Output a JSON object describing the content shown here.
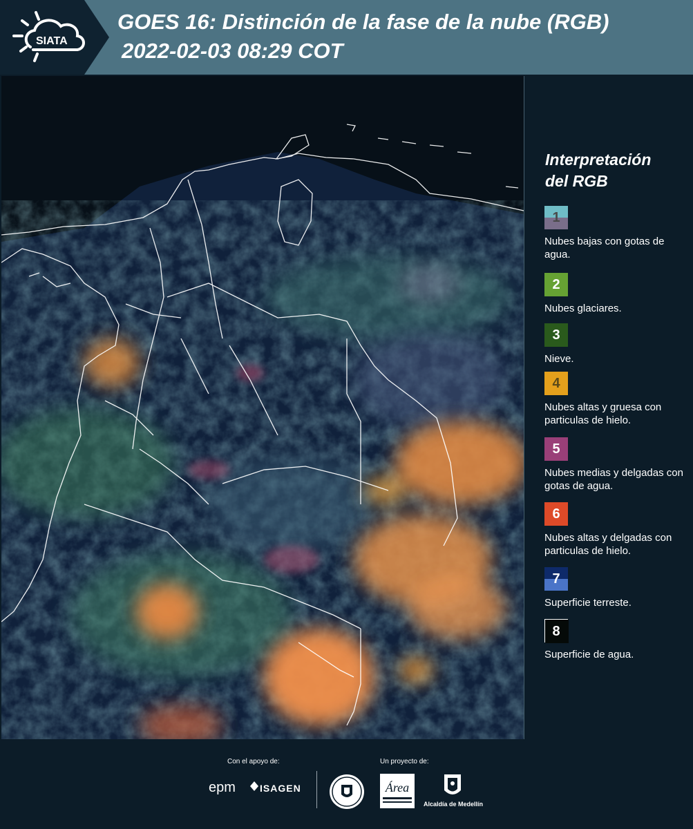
{
  "header": {
    "logo_text": "SIATA",
    "title_line1": "GOES 16: Distinción de la fase de la nube (RGB)",
    "title_line2": "2022-02-03 08:29 COT"
  },
  "legend": {
    "title_line1": "Interpretación",
    "title_line2": "del RGB",
    "items": [
      {
        "number": "1",
        "label": "Nubes bajas con gotas de agua.",
        "color_top": "#6fbcc6",
        "color_bottom": "#7a6e8a",
        "number_color": "#4a4a4a"
      },
      {
        "number": "2",
        "label": "Nubes glaciares.",
        "color_top": "#66a233",
        "color_bottom": "#66a233",
        "number_color": "#ffffff"
      },
      {
        "number": "3",
        "label": "Nieve.",
        "color_top": "#2a5a1c",
        "color_bottom": "#2a5a1c",
        "number_color": "#ffffff"
      },
      {
        "number": "4",
        "label": "Nubes altas y gruesa con particulas de hielo.",
        "color_top": "#e4a01c",
        "color_bottom": "#e4a01c",
        "number_color": "#5a4a1a"
      },
      {
        "number": "5",
        "label": "Nubes medias y delgadas con gotas de agua.",
        "color_top": "#9a3f78",
        "color_bottom": "#9a3f78",
        "number_color": "#ffffff"
      },
      {
        "number": "6",
        "label": "Nubes altas y delgadas con particulas de hielo.",
        "color_top": "#de4a28",
        "color_bottom": "#de4a28",
        "number_color": "#ffffff"
      },
      {
        "number": "7",
        "label": "Superficie terreste.",
        "color_top": "#0e2a6a",
        "color_bottom": "#4a74c8",
        "number_color": "#ffffff"
      },
      {
        "number": "8",
        "label": "Superficie de agua.",
        "color_top": "#050a08",
        "color_bottom": "#050a08",
        "number_color": "#ffffff"
      }
    ]
  },
  "footer": {
    "support_label": "Con el apoyo de:",
    "project_label": "Un proyecto de:",
    "sponsor_1": "epm",
    "sponsor_2": "ISAGEN",
    "partner_area": "Área",
    "partner_alcaldia": "Alcaldía de Medellín"
  },
  "colors": {
    "header_band": "#4d7383",
    "header_dark": "#0f2230",
    "panel_bg": "#0c1c28"
  }
}
